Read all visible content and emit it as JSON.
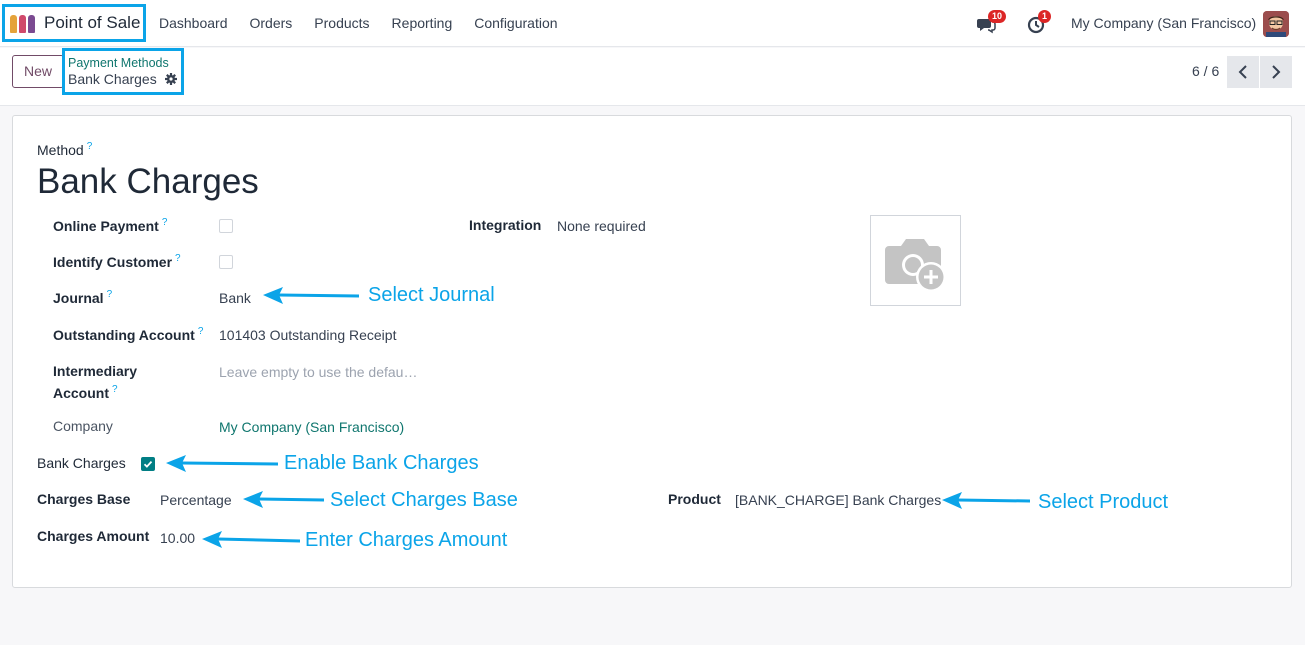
{
  "navbar": {
    "app_name": "Point of Sale",
    "menu": [
      "Dashboard",
      "Orders",
      "Products",
      "Reporting",
      "Configuration"
    ],
    "messages_count": "10",
    "activities_count": "1",
    "company": "My Company (San Francisco)"
  },
  "control": {
    "new_label": "New",
    "breadcrumb_parent": "Payment Methods",
    "breadcrumb_current": "Bank Charges",
    "pager": "6 / 6"
  },
  "form": {
    "method_label": "Method",
    "q": "?",
    "name": "Bank Charges",
    "online_payment_label": "Online Payment",
    "identify_customer_label": "Identify Customer",
    "journal_label": "Journal",
    "journal_value": "Bank",
    "outstanding_label": "Outstanding Account",
    "outstanding_value": "101403 Outstanding Receipt",
    "intermediary_label_1": "Intermediary",
    "intermediary_label_2": "Account",
    "intermediary_placeholder": "Leave empty to use the defau…",
    "company_label": "Company",
    "company_value": "My Company (San Francisco)",
    "integration_label": "Integration",
    "integration_value": "None required",
    "bank_charges_label": "Bank Charges",
    "bank_charges_checked": true,
    "charges_base_label": "Charges Base",
    "charges_base_value": "Percentage",
    "charges_amount_label": "Charges Amount",
    "charges_amount_value": "10.00",
    "product_label": "Product",
    "product_value": "[BANK_CHARGE] Bank Charges"
  },
  "annotations": {
    "journal": "Select Journal",
    "bank_charges": "Enable Bank Charges",
    "charges_base": "Select Charges Base",
    "charges_amount": "Enter Charges Amount",
    "product": "Select Product"
  },
  "colors": {
    "highlight": "#0ba4e8",
    "primary": "#714b67",
    "accent": "#017e84",
    "badge": "#dc2626"
  }
}
